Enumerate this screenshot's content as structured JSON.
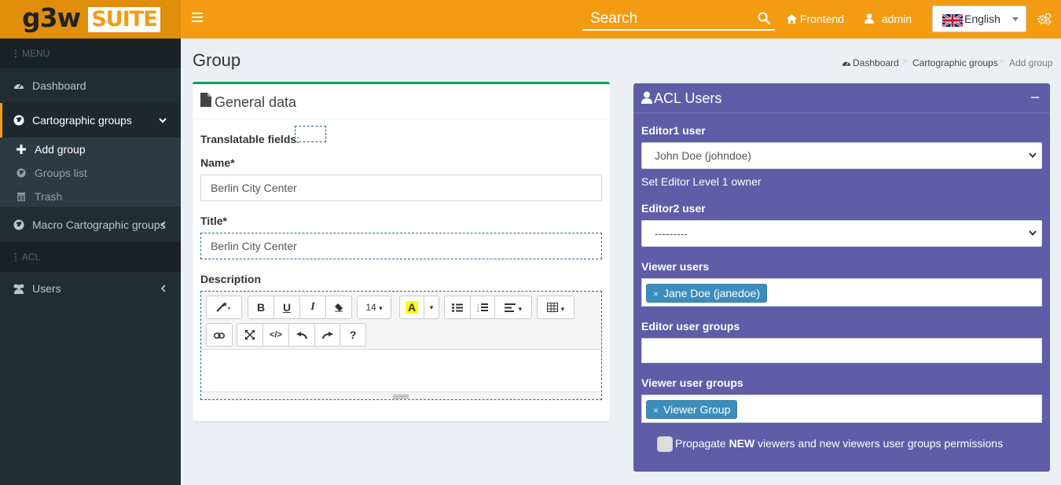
{
  "app": {
    "logo_left": "g3w",
    "logo_right": "SUITE"
  },
  "header": {
    "search_placeholder": "Search",
    "frontend_label": "Frontend",
    "user_label": "admin",
    "language_label": "English"
  },
  "sidebar": {
    "menu_header": "MENU",
    "acl_header": "ACL",
    "items": {
      "dashboard": "Dashboard",
      "cartographic_groups": "Cartographic groups",
      "macro_groups": "Macro Cartographic groups",
      "users": "Users"
    },
    "subitems": {
      "add_group": "Add group",
      "groups_list": "Groups list",
      "trash": "Trash"
    }
  },
  "page": {
    "title": "Group",
    "breadcrumb": [
      "Dashboard",
      "Cartographic groups",
      "Add group"
    ]
  },
  "general_box": {
    "title": "General data",
    "translatable_label": "Translatable fields",
    "translatable_colon": ":",
    "name_label": "Name*",
    "name_value": "Berlin City Center",
    "title_label": "Title*",
    "title_value": "Berlin City Center",
    "description_label": "Description",
    "toolbar": {
      "font_size": "14",
      "help": "?",
      "code": "</>",
      "bold": "B",
      "underline": "U",
      "italic": "I",
      "highlight": "A"
    }
  },
  "acl_box": {
    "title": "ACL Users",
    "editor1_label": "Editor1 user",
    "editor1_value": "John Doe (johndoe)",
    "editor1_help": "Set Editor Level 1 owner",
    "editor2_label": "Editor2 user",
    "editor2_value": "---------",
    "viewer_users_label": "Viewer users",
    "viewer_users_tag": "Jane Doe (janedoe)",
    "editor_groups_label": "Editor user groups",
    "viewer_groups_label": "Viewer user groups",
    "viewer_groups_tag": "Viewer Group",
    "tag_remove": "×",
    "propagate_pre": "Propagate ",
    "propagate_bold": "NEW",
    "propagate_post": " viewers and new viewers user groups permissions"
  },
  "colors": {
    "header": "#f39c12",
    "logo_bg": "#e08e0b",
    "sidebar": "#222d32",
    "acl_box": "#605ca8",
    "general_border": "#00a65a",
    "tag": "#3c8dbc"
  }
}
